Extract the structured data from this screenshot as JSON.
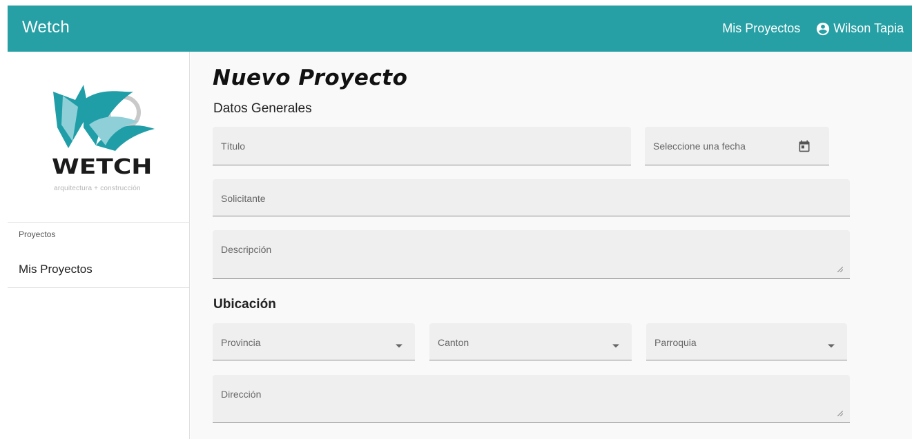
{
  "app": {
    "title": "Wetch"
  },
  "header": {
    "nav_projects": "Mis Proyectos",
    "user_name": "Wilson Tapia"
  },
  "sidebar": {
    "logo_text": "WETCH",
    "logo_subtitle": "arquitectura + construcción",
    "section_label": "Proyectos",
    "items": [
      {
        "label": "Mis Proyectos"
      }
    ]
  },
  "main": {
    "title": "Nuevo Proyecto",
    "general_section": "Datos Generales",
    "location_section": "Ubicación",
    "fields": {
      "titulo": {
        "placeholder": "Título",
        "value": ""
      },
      "fecha": {
        "placeholder": "Seleccione una fecha",
        "value": ""
      },
      "solicitante": {
        "placeholder": "Solicitante",
        "value": ""
      },
      "descripcion": {
        "placeholder": "Descripción",
        "value": ""
      },
      "provincia": {
        "placeholder": "Provincia",
        "value": ""
      },
      "canton": {
        "placeholder": "Canton",
        "value": ""
      },
      "parroquia": {
        "placeholder": "Parroquia",
        "value": ""
      },
      "direccion": {
        "placeholder": "Dirección",
        "value": ""
      }
    }
  },
  "colors": {
    "primary": "#26a0a5",
    "logo_teal": "#1f9ea8",
    "logo_light": "#8fd0d8"
  },
  "icons": [
    "account-circle-icon",
    "calendar-icon",
    "dropdown-arrow-icon",
    "resize-handle-icon"
  ]
}
